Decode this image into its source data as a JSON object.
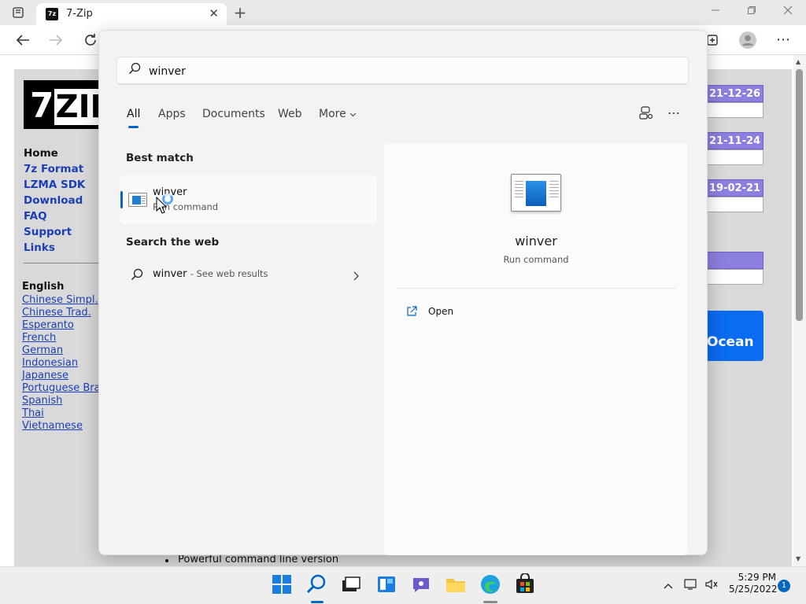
{
  "browser": {
    "tab_title": "7-Zip",
    "favicon_text": "7z",
    "new_tab": "+",
    "tab_close": "✕"
  },
  "website": {
    "logo_seven": "7",
    "logo_zip": "ZIP",
    "menu": [
      "Home",
      "7z Format",
      "LZMA SDK",
      "Download",
      "FAQ",
      "Support",
      "Links"
    ],
    "languages_heading": "English",
    "languages": [
      "Chinese Simpl.",
      "Chinese Trad.",
      "Esperanto",
      "French",
      "German",
      "Indonesian",
      "Japanese",
      "Portuguese Bra",
      "Spanish",
      "Thai",
      "Vietnamese"
    ],
    "dates": [
      "21-12-26",
      "21-11-24",
      "19-02-21"
    ],
    "ocean_text": "Ocean",
    "feature_text": "Powerful command line version"
  },
  "search": {
    "query": "winver",
    "filters": [
      "All",
      "Apps",
      "Documents",
      "Web",
      "More"
    ],
    "best_match_label": "Best match",
    "best_match": {
      "name": "winver",
      "type": "Run command"
    },
    "web_label": "Search the web",
    "web_query": "winver",
    "web_suffix": "- See web results",
    "detail": {
      "name": "winver",
      "type": "Run command",
      "open_label": "Open"
    }
  },
  "taskbar": {
    "time": "5:29 PM",
    "date": "5/25/2022",
    "notification_count": "1"
  },
  "colors": {
    "accent": "#0067c0",
    "site_link": "#1c3fb7",
    "date_box": "#8b7fe0"
  }
}
